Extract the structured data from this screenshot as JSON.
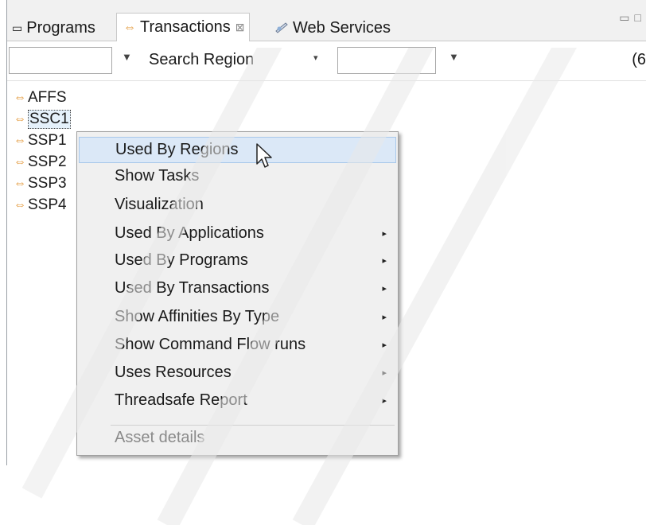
{
  "tabs": [
    {
      "label": "Programs",
      "icon": "window-icon"
    },
    {
      "label": "Transactions",
      "icon": "transaction-icon",
      "close": "⊠"
    },
    {
      "label": "Web Services",
      "icon": "web-services-icon"
    }
  ],
  "toolbar": {
    "search_region_label": "Search Region",
    "count_text": "(6"
  },
  "tree": {
    "items": [
      "AFFS",
      "SSC1",
      "SSP1",
      "SSP2",
      "SSP3",
      "SSP4"
    ],
    "selected": "SSC1"
  },
  "context_menu": {
    "items": [
      {
        "label": "Used By Regions",
        "submenu": false,
        "highlighted": true
      },
      {
        "label": "Show Tasks",
        "submenu": false
      },
      {
        "label": "Visualization",
        "submenu": false
      },
      {
        "label": "Used By Applications",
        "submenu": true
      },
      {
        "label": "Used By Programs",
        "submenu": true
      },
      {
        "label": "Used By Transactions",
        "submenu": true
      },
      {
        "label": "Show Affinities By Type",
        "submenu": true
      },
      {
        "label": "Show Command Flow runs",
        "submenu": true
      },
      {
        "label": "Uses Resources",
        "submenu": true
      },
      {
        "label": "Threadsafe Report",
        "submenu": true
      },
      {
        "label": "Asset details",
        "submenu": false,
        "disabled": true
      }
    ]
  },
  "colors": {
    "accent": "#e0902a",
    "menu_bg": "#f0f0f0",
    "highlight": "#dbe8f7"
  }
}
